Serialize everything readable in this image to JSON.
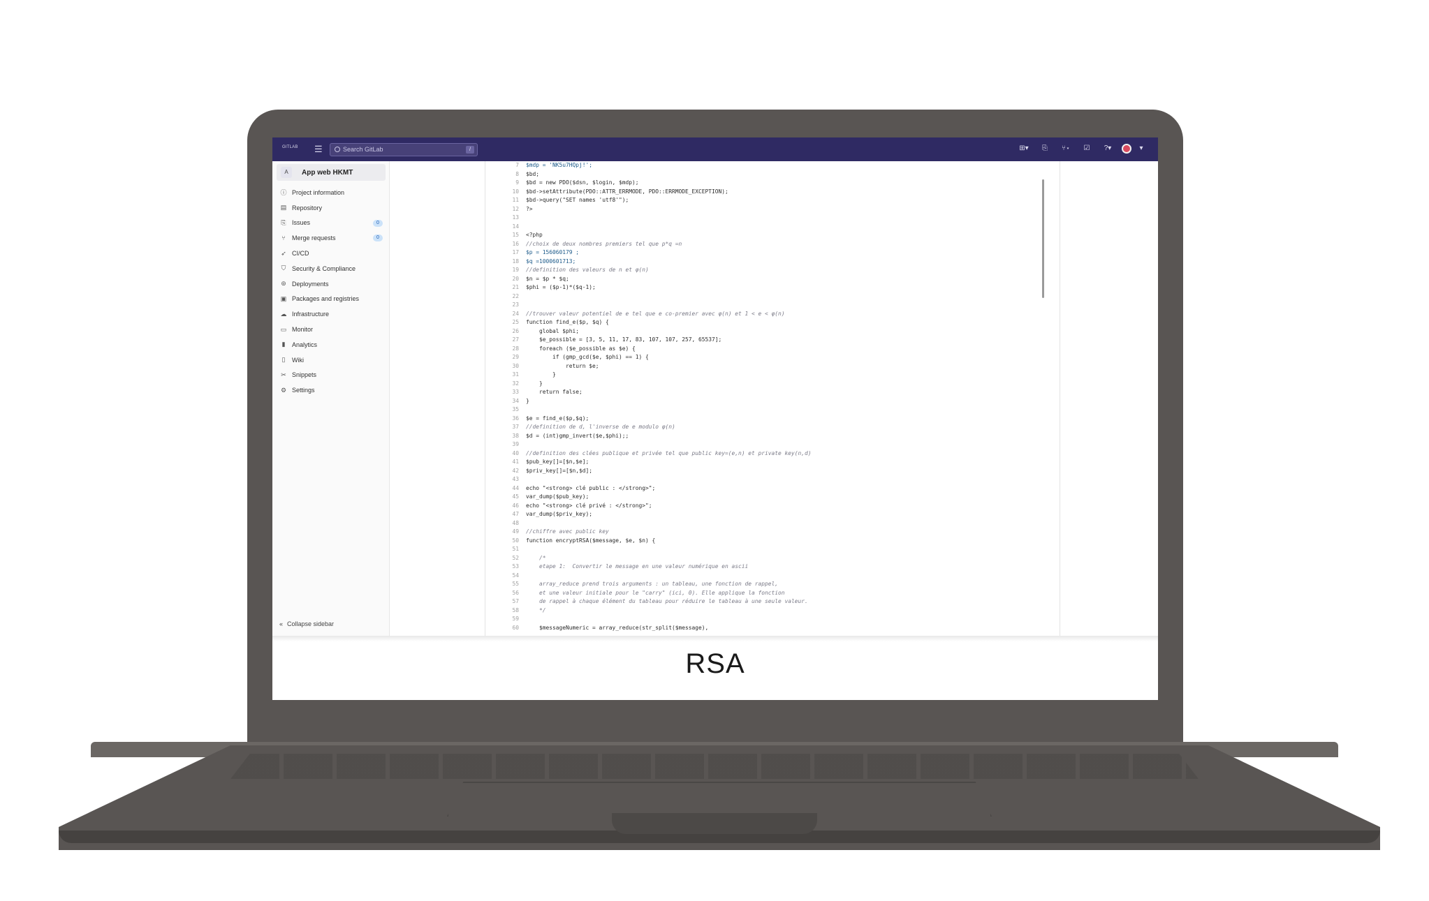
{
  "topbar": {
    "logo_text": "GITLAB",
    "search_placeholder": "Search GitLab",
    "search_shortcut": "/",
    "icons": [
      "plus-icon",
      "issues-icon",
      "merge-requests-icon",
      "todo-icon",
      "help-icon"
    ]
  },
  "sidebar": {
    "project_initial": "A",
    "project_name": "App web HKMT",
    "items": [
      {
        "label": "Project information",
        "icon": "info-icon"
      },
      {
        "label": "Repository",
        "icon": "doc-icon"
      },
      {
        "label": "Issues",
        "icon": "issues-icon",
        "badge": "0"
      },
      {
        "label": "Merge requests",
        "icon": "merge-icon",
        "badge": "0"
      },
      {
        "label": "CI/CD",
        "icon": "rocket-icon"
      },
      {
        "label": "Security & Compliance",
        "icon": "shield-icon"
      },
      {
        "label": "Deployments",
        "icon": "deploy-icon"
      },
      {
        "label": "Packages and registries",
        "icon": "package-icon"
      },
      {
        "label": "Infrastructure",
        "icon": "cloud-icon"
      },
      {
        "label": "Monitor",
        "icon": "monitor-icon"
      },
      {
        "label": "Analytics",
        "icon": "chart-icon"
      },
      {
        "label": "Wiki",
        "icon": "book-icon"
      },
      {
        "label": "Snippets",
        "icon": "scissors-icon"
      },
      {
        "label": "Settings",
        "icon": "gear-icon"
      }
    ],
    "collapse_label": "Collapse sidebar"
  },
  "code": [
    {
      "n": "7",
      "t": "$mdp = 'NK5u7HQpj!';",
      "k": "str"
    },
    {
      "n": "8",
      "t": "$bd;",
      "k": ""
    },
    {
      "n": "9",
      "t": "$bd = new PDO($dsn, $login, $mdp);",
      "k": ""
    },
    {
      "n": "10",
      "t": "$bd->setAttribute(PDO::ATTR_ERRMODE, PDO::ERRMODE_EXCEPTION);",
      "k": ""
    },
    {
      "n": "11",
      "t": "$bd->query(\"SET names 'utf8'\");",
      "k": ""
    },
    {
      "n": "12",
      "t": "?>",
      "k": ""
    },
    {
      "n": "13",
      "t": "",
      "k": ""
    },
    {
      "n": "14",
      "t": "",
      "k": ""
    },
    {
      "n": "15",
      "t": "<?php",
      "k": ""
    },
    {
      "n": "16",
      "t": "//choix de deux nombres premiers tel que p*q =n",
      "k": "cmt"
    },
    {
      "n": "17",
      "t": "$p = 156060179 ;",
      "k": "str"
    },
    {
      "n": "18",
      "t": "$q =1000601713;",
      "k": "str"
    },
    {
      "n": "19",
      "t": "//definition des valeurs de n et φ(n)",
      "k": "cmt"
    },
    {
      "n": "20",
      "t": "$n = $p * $q;",
      "k": ""
    },
    {
      "n": "21",
      "t": "$phi = ($p-1)*($q-1);",
      "k": ""
    },
    {
      "n": "22",
      "t": "",
      "k": ""
    },
    {
      "n": "23",
      "t": "",
      "k": ""
    },
    {
      "n": "24",
      "t": "//trouver valeur potentiel de e tel que e co-premier avec φ(n) et 1 < e < φ(n)",
      "k": "cmt"
    },
    {
      "n": "25",
      "t": "function find_e($p, $q) {",
      "k": ""
    },
    {
      "n": "26",
      "t": "    global $phi;",
      "k": ""
    },
    {
      "n": "27",
      "t": "    $e_possible = [3, 5, 11, 17, 83, 107, 107, 257, 65537];",
      "k": ""
    },
    {
      "n": "28",
      "t": "    foreach ($e_possible as $e) {",
      "k": ""
    },
    {
      "n": "29",
      "t": "        if (gmp_gcd($e, $phi) == 1) {",
      "k": ""
    },
    {
      "n": "30",
      "t": "            return $e;",
      "k": ""
    },
    {
      "n": "31",
      "t": "        }",
      "k": ""
    },
    {
      "n": "32",
      "t": "    }",
      "k": ""
    },
    {
      "n": "33",
      "t": "    return false;",
      "k": ""
    },
    {
      "n": "34",
      "t": "}",
      "k": ""
    },
    {
      "n": "35",
      "t": "",
      "k": ""
    },
    {
      "n": "36",
      "t": "$e = find_e($p,$q);",
      "k": ""
    },
    {
      "n": "37",
      "t": "//definition de d, l'inverse de e modulo φ(n)",
      "k": "cmt"
    },
    {
      "n": "38",
      "t": "$d = (int)gmp_invert($e,$phi);;",
      "k": ""
    },
    {
      "n": "39",
      "t": "",
      "k": ""
    },
    {
      "n": "40",
      "t": "//definition des clées publique et privée tel que public key=(e,n) et private key(n,d)",
      "k": "cmt"
    },
    {
      "n": "41",
      "t": "$pub_key[]=[$n,$e];",
      "k": ""
    },
    {
      "n": "42",
      "t": "$priv_key[]=[$n,$d];",
      "k": ""
    },
    {
      "n": "43",
      "t": "",
      "k": ""
    },
    {
      "n": "44",
      "t": "echo \"<strong> clé public : </strong>\";",
      "k": ""
    },
    {
      "n": "45",
      "t": "var_dump($pub_key);",
      "k": ""
    },
    {
      "n": "46",
      "t": "echo \"<strong> clé privé : </strong>\";",
      "k": ""
    },
    {
      "n": "47",
      "t": "var_dump($priv_key);",
      "k": ""
    },
    {
      "n": "48",
      "t": "",
      "k": ""
    },
    {
      "n": "49",
      "t": "//chiffre avec public key",
      "k": "cmt"
    },
    {
      "n": "50",
      "t": "function encryptRSA($message, $e, $n) {",
      "k": ""
    },
    {
      "n": "51",
      "t": "",
      "k": ""
    },
    {
      "n": "52",
      "t": "    /*",
      "k": "cmt"
    },
    {
      "n": "53",
      "t": "    etape 1:  Convertir le message en une valeur numérique en ascii",
      "k": "cmt"
    },
    {
      "n": "54",
      "t": "",
      "k": ""
    },
    {
      "n": "55",
      "t": "    array_reduce prend trois arguments : un tableau, une fonction de rappel,",
      "k": "cmt"
    },
    {
      "n": "56",
      "t": "    et une valeur initiale pour le \"carry\" (ici, 0). Elle applique la fonction",
      "k": "cmt"
    },
    {
      "n": "57",
      "t": "    de rappel à chaque élément du tableau pour réduire le tableau à une seule valeur.",
      "k": "cmt"
    },
    {
      "n": "58",
      "t": "    */",
      "k": "cmt"
    },
    {
      "n": "59",
      "t": "",
      "k": ""
    },
    {
      "n": "60",
      "t": "    $messageNumeric = array_reduce(str_split($message),",
      "k": ""
    }
  ],
  "caption": "RSA"
}
